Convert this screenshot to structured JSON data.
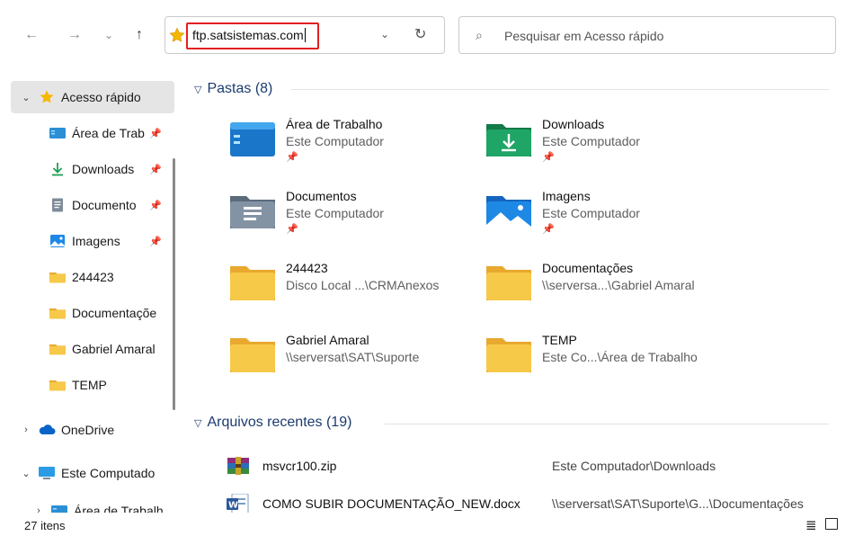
{
  "toolbar": {
    "back_icon": "←",
    "forward_icon": "→",
    "history_icon": "⌄",
    "up_icon": "↑",
    "address_value": "ftp.satsistemas.com",
    "dropdown_icon": "⌄",
    "refresh_icon": "↻",
    "search_icon": "⌕",
    "search_placeholder": "Pesquisar em Acesso rápido"
  },
  "sidebar": {
    "items": [
      {
        "label": "Acesso rápido",
        "chevron": "⌄",
        "icon": "star-icon"
      },
      {
        "label": "Área de Trab",
        "pin": "📌",
        "icon": "desktop-folder-icon"
      },
      {
        "label": "Downloads",
        "pin": "📌",
        "icon": "download-icon"
      },
      {
        "label": "Documento",
        "pin": "📌",
        "icon": "documents-icon"
      },
      {
        "label": "Imagens",
        "pin": "📌",
        "icon": "pictures-icon"
      },
      {
        "label": "244423",
        "icon": "folder-icon"
      },
      {
        "label": "Documentaçõe",
        "icon": "folder-icon"
      },
      {
        "label": "Gabriel Amaral",
        "icon": "folder-icon"
      },
      {
        "label": "TEMP",
        "icon": "folder-icon"
      },
      {
        "label": "OneDrive",
        "chevron": "›",
        "icon": "onedrive-icon"
      },
      {
        "label": "Este Computado",
        "chevron": "⌄",
        "icon": "computer-icon"
      },
      {
        "label": "Área de Trabalh",
        "chevron": "›",
        "icon": "desktop-folder-icon"
      }
    ]
  },
  "main": {
    "folders_header": "Pastas (8)",
    "folders": [
      {
        "name": "Área de Trabalho",
        "location": "Este Computador",
        "pinned": true,
        "icon": "desktop-folder-icon"
      },
      {
        "name": "Downloads",
        "location": "Este Computador",
        "pinned": true,
        "icon": "downloads-folder-icon"
      },
      {
        "name": "Documentos",
        "location": "Este Computador",
        "pinned": true,
        "icon": "documents-folder-icon"
      },
      {
        "name": "Imagens",
        "location": "Este Computador",
        "pinned": true,
        "icon": "pictures-folder-icon"
      },
      {
        "name": "244423",
        "location": "Disco Local ...\\CRMAnexos",
        "pinned": false,
        "icon": "folder-icon"
      },
      {
        "name": "Documentações",
        "location": "\\\\serversa...\\Gabriel Amaral",
        "pinned": false,
        "icon": "folder-icon"
      },
      {
        "name": "Gabriel Amaral",
        "location": "\\\\serversat\\SAT\\Suporte",
        "pinned": false,
        "icon": "folder-icon"
      },
      {
        "name": "TEMP",
        "location": "Este Co...\\Área de Trabalho",
        "pinned": false,
        "icon": "folder-icon"
      }
    ],
    "pin_glyph": "📌",
    "recent_header": "Arquivos recentes (19)",
    "recent": [
      {
        "name": "msvcr100.zip",
        "path": "Este Computador\\Downloads",
        "icon": "winrar-archive-icon"
      },
      {
        "name": "COMO SUBIR DOCUMENTAÇÃO_NEW.docx",
        "path": "\\\\serversat\\SAT\\Suporte\\G...\\Documentações",
        "icon": "word-document-icon"
      }
    ]
  },
  "status": {
    "count": "27 itens",
    "details_view_icon": "≣"
  },
  "colors": {
    "folder_yellow": "#f7c948",
    "folder_back": "#e8a92e",
    "selection": "#e5e5e5",
    "highlight_border": "#e31e24",
    "header_text": "#1b3b6f",
    "accent_blue": "#1e88e5"
  }
}
